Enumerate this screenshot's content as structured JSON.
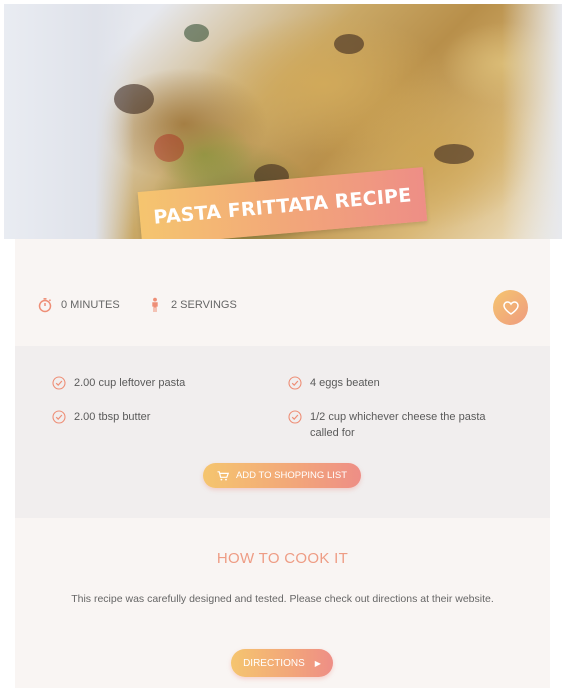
{
  "recipe": {
    "title": "PASTA FRITTATA RECIPE",
    "time": "0 MINUTES",
    "servings": "2 SERVINGS"
  },
  "ingredients": [
    {
      "text": "2.00 cup leftover pasta"
    },
    {
      "text": "4 eggs beaten"
    },
    {
      "text": "2.00 tbsp butter"
    },
    {
      "text": "1/2 cup whichever cheese the pasta called for"
    }
  ],
  "actions": {
    "shopping_list_label": "ADD TO SHOPPING LIST",
    "directions_label": "DIRECTIONS"
  },
  "cook": {
    "heading": "HOW TO COOK IT",
    "text": "This recipe was carefully designed and tested. Please check out directions at their website."
  },
  "colors": {
    "accent_start": "#f5c56f",
    "accent_end": "#ee8e86",
    "heading": "#ee9c84",
    "icon": "#ee8e76"
  },
  "icons": {
    "time": "stopwatch-icon",
    "servings": "person-icon",
    "favorite": "heart-icon",
    "check": "check-circle-icon",
    "cart": "cart-icon",
    "arrow": "play-arrow-icon"
  }
}
